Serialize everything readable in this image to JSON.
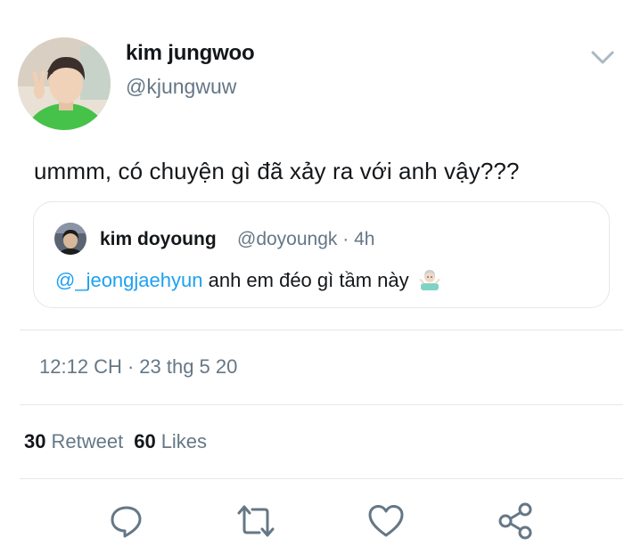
{
  "author": {
    "name": "kim jungwoo",
    "handle": "@kjungwuw",
    "avatar_icon": "profile-photo"
  },
  "tweet": {
    "text": "ummm, có chuyện gì đã xảy ra với anh vậy???"
  },
  "quoted_tweet": {
    "name": "kim doyoung",
    "handle": "@doyoungk",
    "separator": "·",
    "age": "4h",
    "mention": "@_jeongjaehyun",
    "text": "anh em đéo gì tầm này",
    "emoji_icon": "person-shrugging-emoji"
  },
  "meta": {
    "time": "12:12 CH",
    "separator": "·",
    "date": "23 thg 5 20"
  },
  "stats": {
    "retweets_count": "30",
    "retweets_label": "Retweet",
    "likes_count": "60",
    "likes_label": "Likes"
  },
  "actions": [
    "reply-icon",
    "retweet-icon",
    "like-icon",
    "share-icon"
  ],
  "colors": {
    "text": "#14171a",
    "secondary": "#657786",
    "link": "#1da1f2",
    "border": "#e1e8ed",
    "icon": "#657786"
  }
}
